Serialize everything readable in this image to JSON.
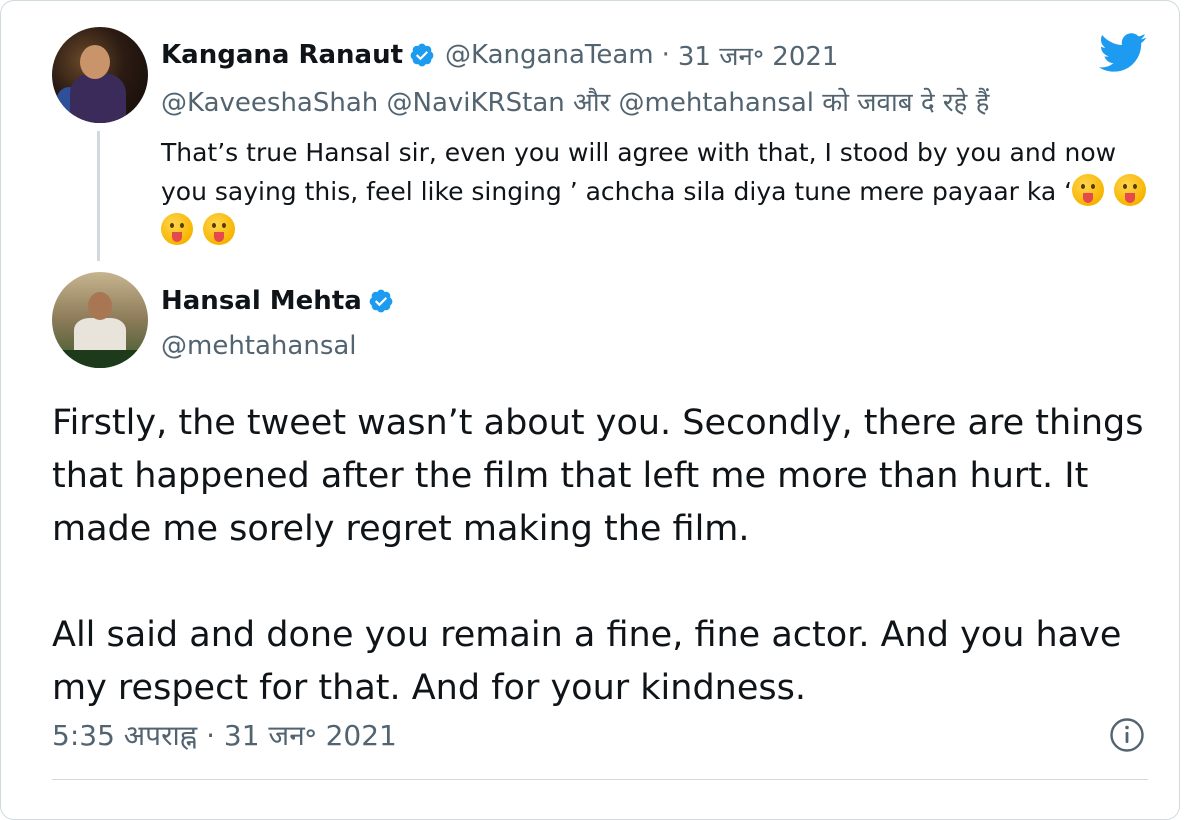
{
  "quoted_tweet": {
    "author_name": "Kangana Ranaut",
    "handle": "@KanganaTeam",
    "separator": "·",
    "date": "31 जन॰ 2021",
    "reply_to": "@KaveeshaShah @NaviKRStan और @mehtahansal को जवाब दे रहे हैं",
    "text": "That’s true Hansal sir, even you will agree with that, I stood by you and now you saying this, feel like singing ’ achcha sila diya tune mere payaar ka ‘",
    "emoji_count": 4,
    "emoji_name": "face-with-tongue-emoji"
  },
  "main_tweet": {
    "author_name": "Hansal Mehta",
    "handle": "@mehtahansal",
    "paragraph_1": "Firstly, the tweet wasn’t about you. Secondly, there are things that happened after the film that left me more than hurt. It made me sorely regret making the film.",
    "paragraph_2": "All said and done you remain a fine, fine actor. And you have my respect for that. And for your kindness.",
    "timestamp": "5:35 अपराह्न · 31 जन॰ 2021"
  },
  "colors": {
    "verified_blue": "#1d9bf0",
    "text_primary": "#0f1419",
    "text_muted": "#536471",
    "border": "#cfd9de",
    "twitter_blue": "#1d9bf0"
  },
  "icons": [
    "twitter-bird-icon",
    "verified-badge-icon",
    "info-icon"
  ]
}
